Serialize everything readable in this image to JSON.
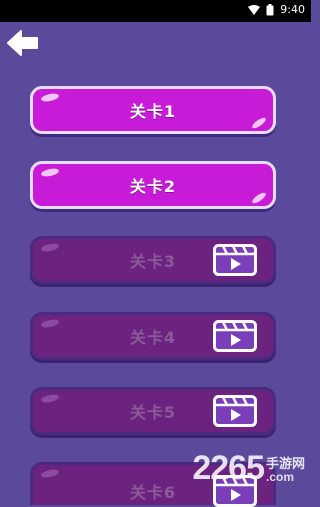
{
  "status_bar": {
    "time": "9:40",
    "icons": [
      "wifi-icon",
      "battery-icon"
    ]
  },
  "header": {
    "back_icon": "arrow-left-icon"
  },
  "colors": {
    "background": "#5b4a9c",
    "unlocked_fill": "#c81bd7",
    "unlocked_border": "#eadcf8",
    "locked_fill": "#6c2380",
    "locked_text": "#8b5a99"
  },
  "levels": [
    {
      "label": "关卡1",
      "locked": false
    },
    {
      "label": "关卡2",
      "locked": false
    },
    {
      "label": "关卡3",
      "locked": true,
      "icon": "video-ad-icon"
    },
    {
      "label": "关卡4",
      "locked": true,
      "icon": "video-ad-icon"
    },
    {
      "label": "关卡5",
      "locked": true,
      "icon": "video-ad-icon"
    },
    {
      "label": "关卡6",
      "locked": true,
      "icon": "video-ad-icon"
    }
  ],
  "watermark": {
    "number": "2265",
    "cn": "手游网",
    "com": ".com"
  }
}
